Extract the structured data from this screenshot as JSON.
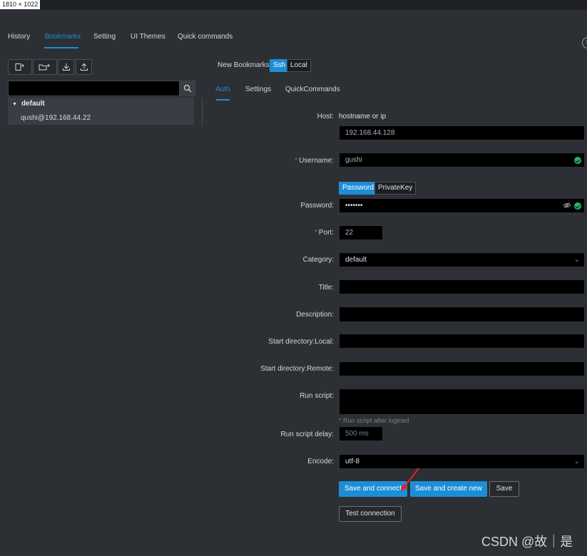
{
  "screenshot_label": "1810 × 1022",
  "nav_tabs": [
    "History",
    "Bookmarks",
    "Setting",
    "UI Themes",
    "Quick commands"
  ],
  "tree": {
    "group": "default",
    "item": "qushi@192.168.44.22"
  },
  "header": {
    "new_bookmarks": "New Bookmarks",
    "ssh": "Ssh",
    "local": "Local"
  },
  "sub_tabs": [
    "Auth",
    "Settings",
    "QuickCommands"
  ],
  "form": {
    "host_label": "Host:",
    "host_hint": "hostname or ip",
    "host_value": "192.168.44.128",
    "username_label": "Username:",
    "username_value": "gushi",
    "auth_password": "Password",
    "auth_privatekey": "PrivateKey",
    "password_label": "Password:",
    "password_value": "•••••••",
    "port_label": "Port:",
    "port_value": "22",
    "category_label": "Category:",
    "category_value": "default",
    "title_label": "Title:",
    "description_label": "Description:",
    "start_local_label": "Start directory:Local:",
    "start_remote_label": "Start directory:Remote:",
    "run_script_label": "Run script:",
    "run_script_hint": "* Run script after logined",
    "run_delay_label": "Run script delay:",
    "run_delay_placeholder": "500 ms",
    "encode_label": "Encode:",
    "encode_value": "utf-8"
  },
  "buttons": {
    "save_connect": "Save and connect",
    "save_create": "Save and create new",
    "save": "Save",
    "test": "Test connection"
  },
  "watermark": "CSDN @故｜是",
  "colors": {
    "accent": "#1c8ed6",
    "background": "#2c2f33",
    "input_bg": "#000000",
    "success": "#1fb86a",
    "required": "#e04a4a"
  },
  "icons": {
    "new_bookmark": "file-plus-icon",
    "new_folder": "folder-plus-icon",
    "import": "download-icon",
    "export": "upload-icon",
    "search": "search-icon",
    "close": "close-icon"
  }
}
